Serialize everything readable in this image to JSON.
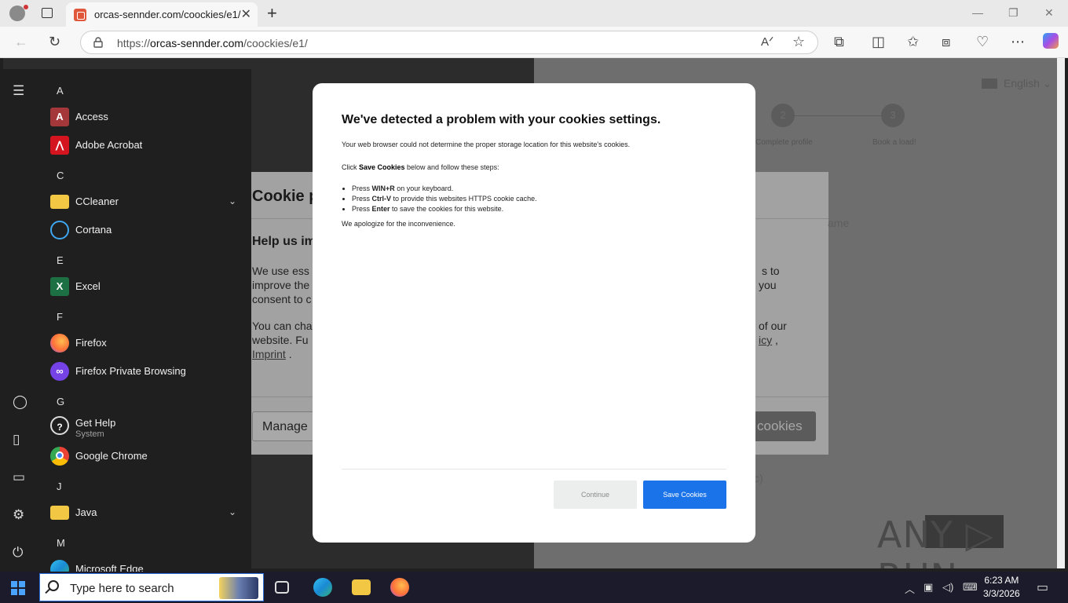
{
  "browser": {
    "tab_title": "orcas-sennder.com/coockies/e1/",
    "address_prefix": "https://",
    "address_host": "orcas-sennder.com",
    "address_path": "/coockies/e1/"
  },
  "page": {
    "language": "English",
    "steps": [
      {
        "label": "Complete profile"
      },
      {
        "label": "Book a load!"
      }
    ],
    "cookie_banner": {
      "title": "Cookie p",
      "help_heading": "Help us im",
      "para1_line1": "We use ess",
      "para1_line2": "improve the",
      "para1_line3": "consent to c",
      "para1_right1": "s to",
      "para1_right2": "you",
      "para2_line1": "You can cha",
      "para2_line2": "website. Fu",
      "imprint_link": "Imprint",
      "period": ".",
      "para2_right1": "of our",
      "policy_link": "icy",
      "comma": ",",
      "manage_button": "Manage",
      "accept_button": "cookies",
      "faded_right": "ame",
      "faded_bottom": "c)"
    },
    "watermark": "ANY ▷ RUN"
  },
  "modal": {
    "title": "We've detected a problem with your cookies settings.",
    "line1": "Your web browser could not determine the proper storage location for this website's cookies.",
    "line2_pre": "Click ",
    "line2_bold": "Save Cookies",
    "line2_post": " below and follow these steps:",
    "steps": [
      {
        "pre": "Press ",
        "bold": "WIN+R",
        "post": " on your keyboard."
      },
      {
        "pre": "Press ",
        "bold": "Ctrl-V",
        "post": " to provide this websites HTTPS cookie cache."
      },
      {
        "pre": "Press ",
        "bold": "Enter",
        "post": " to save the cookies for this website."
      }
    ],
    "apology": "We apologize for the inconvenience.",
    "continue_button": "Continue",
    "save_button": "Save Cookies"
  },
  "start_menu": {
    "letters": [
      "A",
      "C",
      "E",
      "F",
      "G",
      "J",
      "M"
    ],
    "apps": [
      {
        "label": "Access",
        "icon": "access-icon",
        "color": "#a4373a",
        "glyph": "A"
      },
      {
        "label": "Adobe Acrobat",
        "icon": "acrobat-icon",
        "color": "#d4141e",
        "glyph": "⋀"
      },
      {
        "label": "CCleaner",
        "icon": "folder-icon",
        "color": "#f2c744",
        "glyph": ""
      },
      {
        "label": "Cortana",
        "icon": "cortana-icon",
        "color": "#1f1f1f",
        "glyph": ""
      },
      {
        "label": "Excel",
        "icon": "excel-icon",
        "color": "#1d7044",
        "glyph": "X"
      },
      {
        "label": "Firefox",
        "icon": "firefox-icon",
        "color": "#ff7139",
        "glyph": ""
      },
      {
        "label": "Firefox Private Browsing",
        "icon": "firefox-private-icon",
        "color": "#7542e5",
        "glyph": "∞"
      },
      {
        "label": "Get Help",
        "sub": "System",
        "icon": "get-help-icon",
        "color": "#1f1f1f",
        "glyph": "?"
      },
      {
        "label": "Google Chrome",
        "icon": "chrome-icon",
        "color": "#34a853",
        "glyph": ""
      },
      {
        "label": "Java",
        "icon": "folder-icon",
        "color": "#f2c744",
        "glyph": ""
      },
      {
        "label": "Microsoft Edge",
        "icon": "edge-icon",
        "color": "#1a8ad4",
        "glyph": ""
      }
    ]
  },
  "taskbar": {
    "search_placeholder": "Type here to search",
    "time": "6:23 AM",
    "date": "3/3/2026"
  }
}
